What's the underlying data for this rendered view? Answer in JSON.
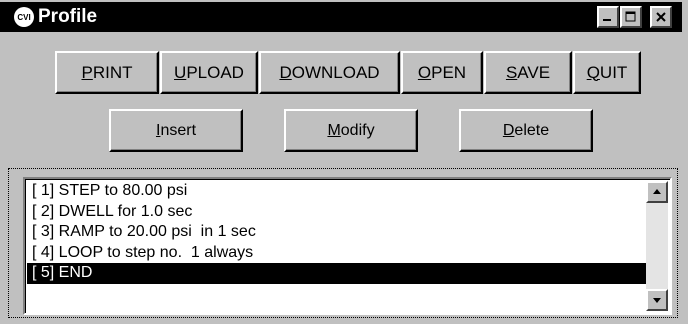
{
  "window": {
    "title": "Profile",
    "icon": "cvi-app-icon",
    "icon_text": "CVI"
  },
  "toolbar": {
    "print": "PRINT",
    "upload": "UPLOAD",
    "download": "DOWNLOAD",
    "open": "OPEN",
    "save": "SAVE",
    "quit": "QUIT"
  },
  "actions": {
    "insert": "Insert",
    "modify": "Modify",
    "delete": "Delete"
  },
  "steps": [
    "[ 1] STEP to 80.00 psi",
    "[ 2] DWELL for 1.0 sec",
    "[ 3] RAMP to 20.00 psi  in 1 sec",
    "[ 4] LOOP to step no.  1 always",
    "[ 5] END"
  ],
  "selected_step": 5,
  "colors": {
    "titlebar": "#000000",
    "face": "#c0c0c0",
    "selection": "#000000",
    "background": "#d3e3e6"
  }
}
